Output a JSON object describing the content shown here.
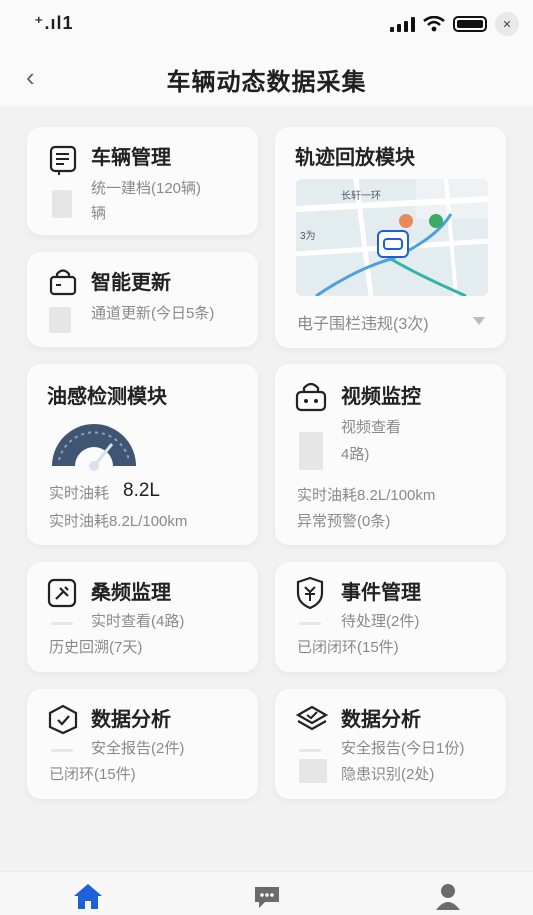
{
  "status": {
    "left_text": "⁺.ıl1",
    "close_glyph": "✕"
  },
  "header": {
    "back_icon": "chevron-left-icon",
    "title": "车辆动态数据采集"
  },
  "cards": {
    "vehicle": {
      "title": "车辆管理",
      "line1": "统一建档(120辆)",
      "line2": "辆"
    },
    "track": {
      "title": "轨迹回放模块",
      "map_street": "长轩一环",
      "map_label": "3为",
      "footer": "电子围栏违规(3次)"
    },
    "smart": {
      "title": "智能更新",
      "line1": "通道更新(今日5条)"
    },
    "fuel": {
      "title": "油感检测模块",
      "label": "实时油耗",
      "value": "8.2L",
      "line2": "实时油耗8.2L/100km",
      "gauge_level": 0.55
    },
    "video": {
      "title": "视频监控",
      "line1": "视频查看",
      "line2": "4路)",
      "line3": "实时油耗8.2L/100km",
      "line4": "异常预警(0条)"
    },
    "freq": {
      "title": "桑频监理",
      "line1": "实时查看(4路)",
      "line2": "历史回溯(7天)"
    },
    "event": {
      "title": "事件管理",
      "line1": "待处理(2件)",
      "line2": "已闭闭环(15件)"
    },
    "data1": {
      "title": "数据分析",
      "line1": "安全报告(2件)",
      "line2": "已闭环(15件)"
    },
    "data2": {
      "title": "数据分析",
      "line1": "安全报告(今日1份)",
      "line2": "隐患识别(2处)"
    }
  },
  "tabbar": {
    "items": [
      "home-icon",
      "chat-icon",
      "user-icon"
    ],
    "active_color": "#1f5fd8"
  }
}
